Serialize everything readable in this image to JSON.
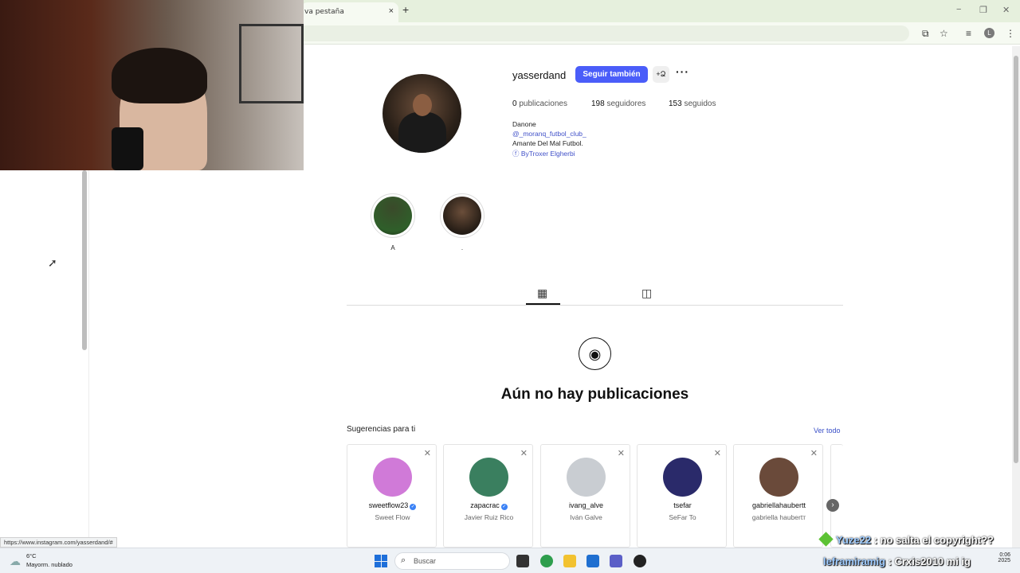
{
  "browser": {
    "tab_title": "va pestaña",
    "tab_close": "×",
    "new_tab": "+",
    "window_controls": {
      "minimize": "−",
      "maximize": "❐",
      "close": "✕"
    },
    "profile_initial": "L"
  },
  "profile": {
    "username": "yasserdand",
    "follow_button": "Seguir también",
    "add_user_icon": "+Ձ",
    "more_icon": "···",
    "posts_count": "0",
    "posts_label": "publicaciones",
    "followers_count": "198",
    "followers_label": "seguidores",
    "following_count": "153",
    "following_label": "seguidos",
    "bio_name": "Danone",
    "bio_mention": "@_moranq_futbol_club_",
    "bio_text": "Amante Del Mal Futbol.",
    "bio_facebook": "ByTroxer Elgherbi"
  },
  "highlights": [
    {
      "label": "A"
    },
    {
      "label": "."
    }
  ],
  "tabs": {
    "posts_icon": "grid-icon",
    "tagged_icon": "tagged-icon"
  },
  "empty_state": {
    "title": "Aún no hay publicaciones"
  },
  "suggestions": {
    "title": "Sugerencias para ti",
    "see_all": "Ver todo",
    "cards": [
      {
        "username": "sweetflow23",
        "name": "Sweet Flow",
        "verified": true,
        "avatar_color": "#d07ad8"
      },
      {
        "username": "zapacrac",
        "name": "Javier Ruiz Rico",
        "verified": true,
        "avatar_color": "#3a7f5f"
      },
      {
        "username": "ivang_alve",
        "name": "Iván Galve",
        "verified": false,
        "avatar_color": "#c9cdd2"
      },
      {
        "username": "tsefar",
        "name": "SeFar To",
        "verified": false,
        "avatar_color": "#2a2a6a"
      },
      {
        "username": "gabriellahaubertt",
        "name": "gabriella haubertт",
        "verified": false,
        "avatar_color": "#6a4a3a"
      }
    ]
  },
  "status_url": "https://www.instagram.com/yasserdand/#",
  "taskbar": {
    "temperature": "6°C",
    "weather": "Mayorm. nublado",
    "search_placeholder": "Buscar",
    "time": "0:06",
    "date": "2025"
  },
  "chat": {
    "line1_user": "Yuze22",
    "line1_text": ": no salta el copyright??",
    "line2_user": "leframiramig",
    "line2_text": ": Crxis2010 mi ig"
  }
}
